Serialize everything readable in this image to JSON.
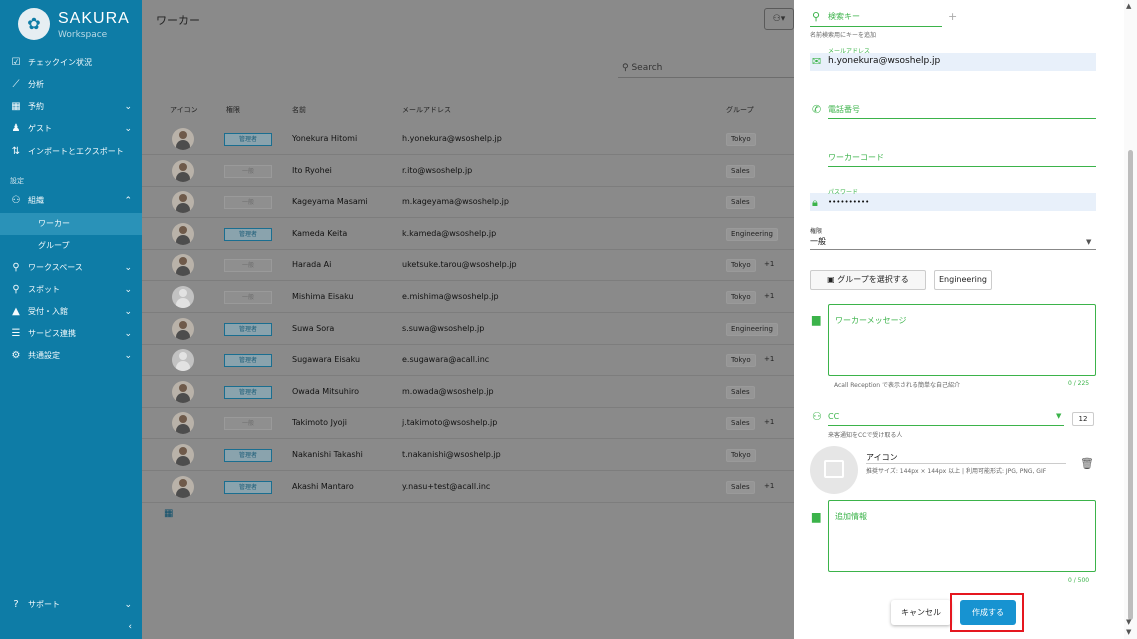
{
  "brand": {
    "name": "SAKURA",
    "sub": "Workspace"
  },
  "sidebar": {
    "items": [
      {
        "label": "チェックイン状況"
      },
      {
        "label": "分析"
      },
      {
        "label": "予約"
      },
      {
        "label": "ゲスト"
      },
      {
        "label": "インポートとエクスポート"
      }
    ],
    "section_label": "設定",
    "settings_items": [
      {
        "label": "組織"
      },
      {
        "label": "ワーカー"
      },
      {
        "label": "グループ"
      },
      {
        "label": "ワークスペース"
      },
      {
        "label": "スポット"
      },
      {
        "label": "受付・入館"
      },
      {
        "label": "サービス連携"
      },
      {
        "label": "共通設定"
      }
    ],
    "support": "サポート",
    "collapse": "‹"
  },
  "main": {
    "title": "ワーカー",
    "search_placeholder": "Search",
    "columns": {
      "icon": "アイコン",
      "role": "権限",
      "name": "名前",
      "email": "メールアドレス",
      "group": "グループ"
    },
    "rows": [
      {
        "role": "管理者",
        "admin": true,
        "name": "Yonekura Hitomi",
        "email": "h.yonekura@wsoshelp.jp",
        "group": "Tokyo",
        "extra": "",
        "blank": false
      },
      {
        "role": "一般",
        "admin": false,
        "name": "Ito Ryohei",
        "email": "r.ito@wsoshelp.jp",
        "group": "Sales",
        "extra": "",
        "blank": false
      },
      {
        "role": "一般",
        "admin": false,
        "name": "Kageyama Masami",
        "email": "m.kageyama@wsoshelp.jp",
        "group": "Sales",
        "extra": "",
        "blank": false
      },
      {
        "role": "管理者",
        "admin": true,
        "name": "Kameda Keita",
        "email": "k.kameda@wsoshelp.jp",
        "group": "Engineering",
        "extra": "",
        "blank": false
      },
      {
        "role": "一般",
        "admin": false,
        "name": "Harada Ai",
        "email": "uketsuke.tarou@wsoshelp.jp",
        "group": "Tokyo",
        "extra": "+1",
        "blank": false
      },
      {
        "role": "一般",
        "admin": false,
        "name": "Mishima Eisaku",
        "email": "e.mishima@wsoshelp.jp",
        "group": "Tokyo",
        "extra": "+1",
        "blank": true
      },
      {
        "role": "管理者",
        "admin": true,
        "name": "Suwa Sora",
        "email": "s.suwa@wsoshelp.jp",
        "group": "Engineering",
        "extra": "",
        "blank": false
      },
      {
        "role": "管理者",
        "admin": true,
        "name": "Sugawara Eisaku",
        "email": "e.sugawara@acall.inc",
        "group": "Tokyo",
        "extra": "+1",
        "blank": true
      },
      {
        "role": "管理者",
        "admin": true,
        "name": "Owada Mitsuhiro",
        "email": "m.owada@wsoshelp.jp",
        "group": "Sales",
        "extra": "",
        "blank": false
      },
      {
        "role": "一般",
        "admin": false,
        "name": "Takimoto Jyoji",
        "email": "j.takimoto@wsoshelp.jp",
        "group": "Sales",
        "extra": "+1",
        "blank": false
      },
      {
        "role": "管理者",
        "admin": true,
        "name": "Nakanishi Takashi",
        "email": "t.nakanishi@wsoshelp.jp",
        "group": "Tokyo",
        "extra": "",
        "blank": false
      },
      {
        "role": "管理者",
        "admin": true,
        "name": "Akashi Mantaro",
        "email": "y.nasu+test@acall.inc",
        "group": "Sales",
        "extra": "+1",
        "blank": false
      }
    ]
  },
  "panel": {
    "search_key_label": "検索キー",
    "search_key_hint": "名前検索用にキーを追加",
    "email_label": "メールアドレス",
    "email_value": "h.yonekura@wsoshelp.jp",
    "phone_placeholder": "電話番号",
    "worker_code_placeholder": "ワーカーコード",
    "password_label": "パスワード",
    "password_value": "••••••••••",
    "role_label": "権限",
    "role_value": "一般",
    "group_button": "グループを選択する",
    "group_chip": "Engineering",
    "message_placeholder": "ワーカーメッセージ",
    "message_hint": "Acall Reception で表示される簡単な自己紹介",
    "message_counter": "0 / 225",
    "cc_label": "CC",
    "cc_count": "12",
    "cc_hint": "来客通知をCCで受け取る人",
    "icon_label": "アイコン",
    "icon_hint": "推奨サイズ: 144px × 144px 以上 | 利用可能形式: JPG, PNG, GIF",
    "extra_placeholder": "追加情報",
    "extra_counter": "0 / 500",
    "cancel": "キャンセル",
    "create": "作成する"
  },
  "colors": {
    "sidebar": "#0e7ca6",
    "accent_green": "#3bb34a",
    "primary_button": "#1793d1",
    "highlight": "#e5171f"
  }
}
